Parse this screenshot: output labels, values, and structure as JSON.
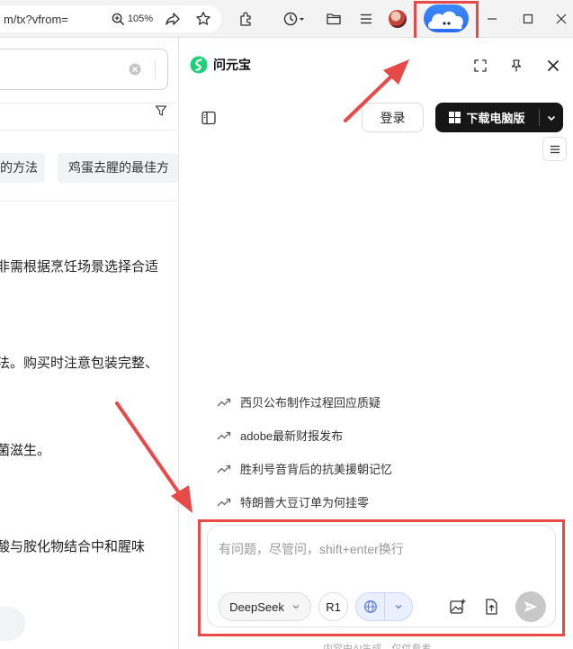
{
  "browser": {
    "url_text": "m/tx?vfrom=",
    "zoom": "105%"
  },
  "left_page": {
    "chips": [
      "的方法",
      "鸡蛋去腥的最佳方"
    ],
    "lines": [
      "非需根据烹饪场景选择合适",
      "法。购买时注意包装完整、",
      "菌滋生。",
      "酸与胺化物结合中和腥味"
    ]
  },
  "panel": {
    "brand_name": "问元宝",
    "login_label": "登录",
    "download_label": "下载电脑版",
    "suggestions": [
      "西贝公布制作过程回应质疑",
      "adobe最新财报发布",
      "胜利号音背后的抗美援朝记忆",
      "特朗普大豆订单为何挂零"
    ],
    "composer": {
      "placeholder": "有问题，尽管问，shift+enter换行",
      "model_label": "DeepSeek",
      "r1_label": "R1"
    },
    "footer_text": "内容由AI生成，仅供参考"
  },
  "colors": {
    "accent_red": "#e84a4a",
    "brand_green": "#1ecf7a",
    "dark_button": "#161616",
    "globe_blue": "#5b7de8"
  }
}
